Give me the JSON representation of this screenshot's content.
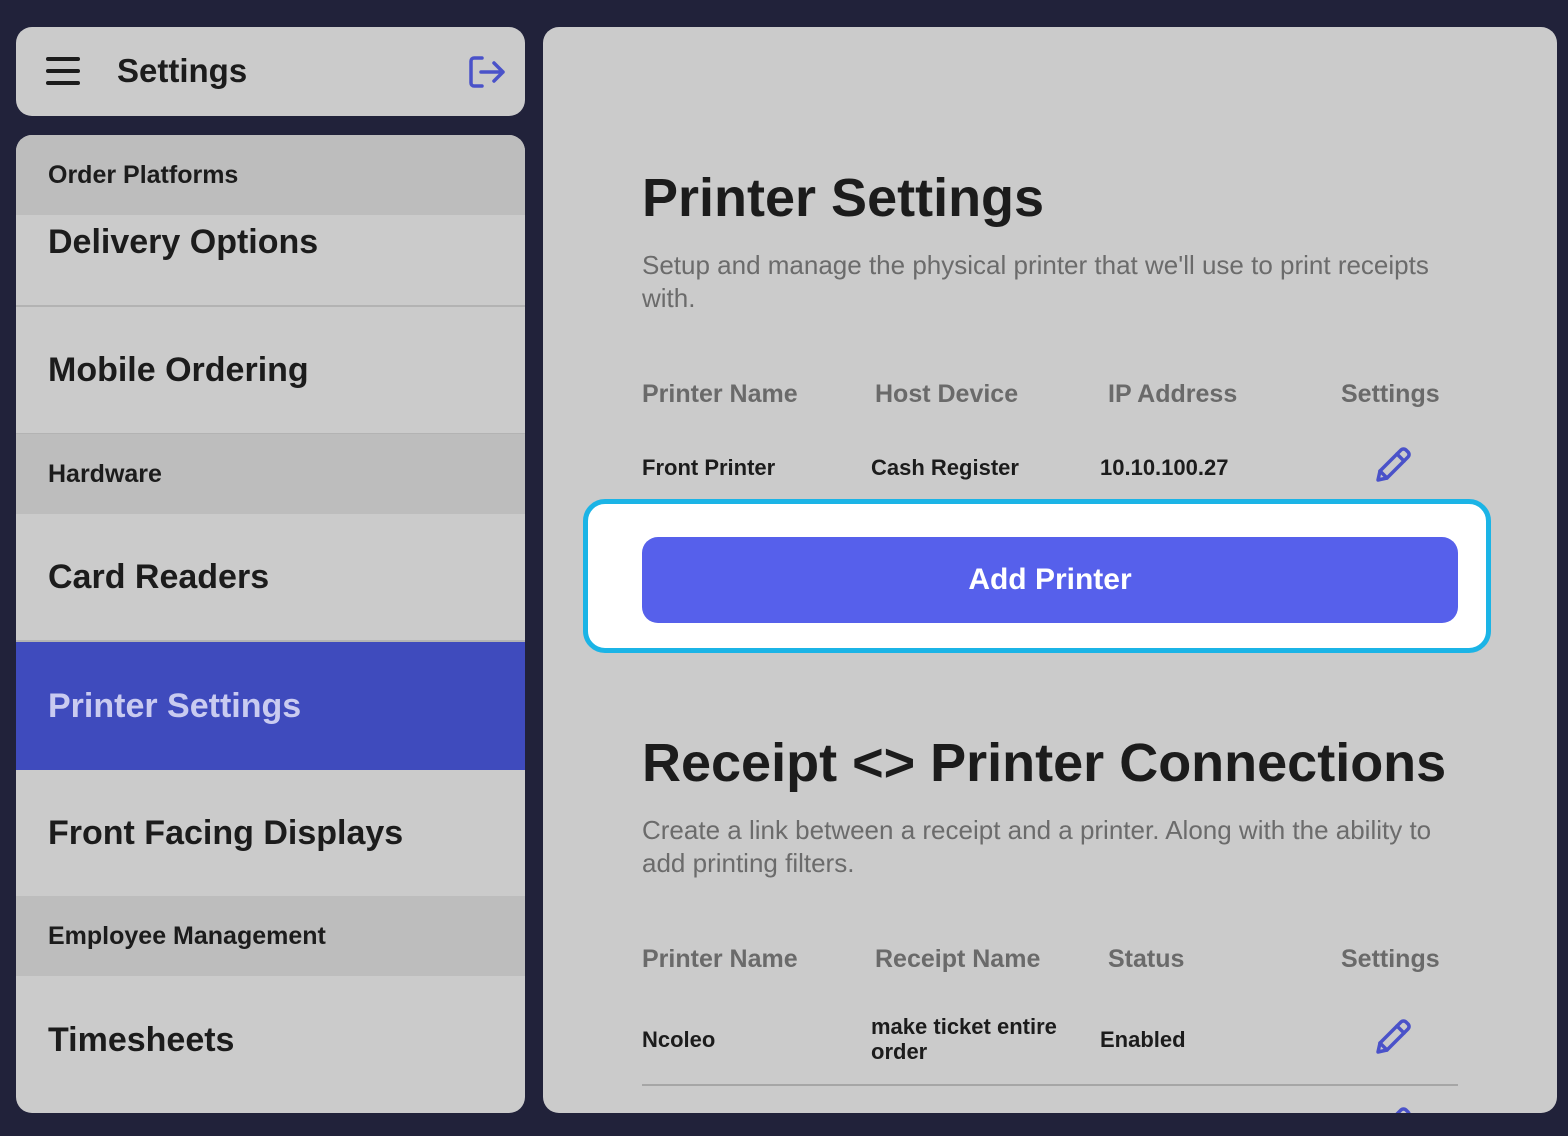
{
  "header": {
    "title": "Settings",
    "menu_icon": "hamburger-icon",
    "logout_icon": "logout-icon"
  },
  "sidebar": {
    "sections": [
      {
        "header": "Order Platforms",
        "items": [
          "Delivery Options",
          "Mobile Ordering"
        ]
      },
      {
        "header": "Hardware",
        "items": [
          "Card Readers",
          "Printer Settings",
          "Front Facing Displays"
        ]
      },
      {
        "header": "Employee Management",
        "items": [
          "Timesheets"
        ]
      }
    ],
    "active_item": "Printer Settings"
  },
  "printer_settings": {
    "title": "Printer Settings",
    "description": "Setup and manage the physical printer that we'll use to print receipts with.",
    "columns": [
      "Printer Name",
      "Host Device",
      "IP Address",
      "Settings"
    ],
    "rows": [
      {
        "printer_name": "Front Printer",
        "host_device": "Cash Register",
        "ip_address": "10.10.100.27",
        "settings_icon": "pencil-icon"
      }
    ],
    "add_button": "Add Printer"
  },
  "connections": {
    "title": "Receipt <> Printer Connections",
    "description": "Create a link between a receipt and a printer. Along with the ability to add printing filters.",
    "columns": [
      "Printer Name",
      "Receipt Name",
      "Status",
      "Settings"
    ],
    "rows": [
      {
        "printer_name": "Ncoleo",
        "receipt_name": "make ticket entire order",
        "status": "Enabled",
        "settings_icon": "pencil-icon"
      }
    ]
  },
  "colors": {
    "accent": "#5660eb",
    "active_nav": "#3f4bbd",
    "highlight": "#1bb4e6",
    "background": "#21223a"
  }
}
